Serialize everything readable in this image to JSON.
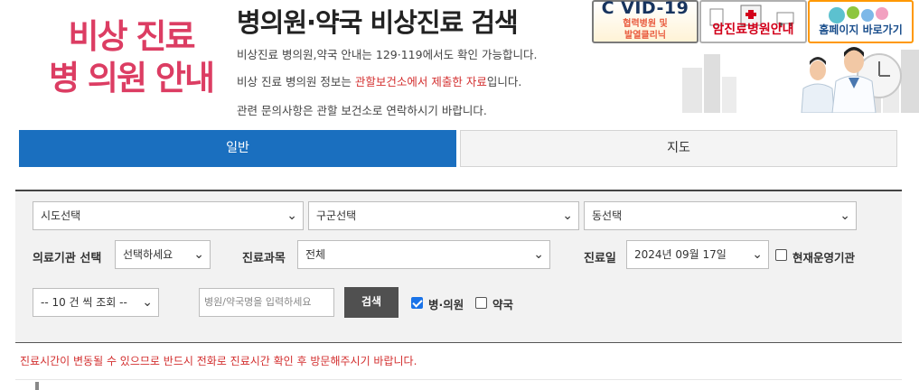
{
  "header": {
    "brand_line1": "비상 진료",
    "brand_line2": "병 의원 안내",
    "title": "병의원·약국 비상진료 검색",
    "desc1": "비상진료 병의원,약국 안내는 129·119에서도 확인 가능합니다.",
    "desc2_pre": "비상 진료 병의원 정보는 ",
    "desc2_hl": "관할보건소에서 제출한 자료",
    "desc2_post": "입니다.",
    "desc3": "관련 문의사항은 관할 보건소로 연락하시기 바랍니다."
  },
  "banners": {
    "covid_title": "C VID-19",
    "covid_sub1": "협력병원 및",
    "covid_sub2": "발열클리닉",
    "cancer": "암진료병원안내",
    "homepage": "홈페이지 바로가기"
  },
  "tabs": [
    {
      "label": "일반",
      "active": true
    },
    {
      "label": "지도",
      "active": false
    }
  ],
  "filters": {
    "sido": "시도선택",
    "gugun": "구군선택",
    "dong": "동선택",
    "inst_label": "의료기관 선택",
    "inst_value": "선택하세요",
    "subject_label": "진료과목",
    "subject_value": "전체",
    "date_label": "진료일",
    "date_value": "2024년 09월 17일",
    "operating_label": "현재운영기관",
    "operating_checked": false,
    "per_page": "-- 10 건 씩 조회 --",
    "search_placeholder": "병원/약국명을 입력하세요",
    "search_button": "검색",
    "hospital_label": "병·의원",
    "hospital_checked": true,
    "pharmacy_label": "약국",
    "pharmacy_checked": false
  },
  "notice": "진료시간이 변동될 수 있으므로 반드시 전화로 진료시간 확인 후 방문해주시기 바랍니다.",
  "colors": {
    "brand": "#dc3d63",
    "tab_active": "#1a6fbf",
    "notice": "#d32f2f",
    "search_button": "#505050"
  }
}
